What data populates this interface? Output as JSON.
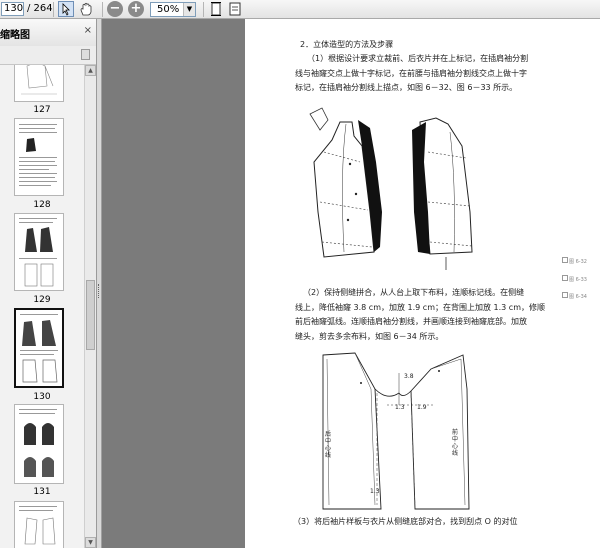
{
  "toolbar": {
    "page_current": "130",
    "page_total": "/ 264",
    "zoom": "50%",
    "icons": [
      "text-select-icon",
      "hand-icon",
      "zoom-out-icon",
      "zoom-in-icon",
      "fit-page-icon",
      "fit-width-icon"
    ]
  },
  "sidebar": {
    "title": "缩略图",
    "close_glyph": "×",
    "thumbnails": [
      {
        "label": "127"
      },
      {
        "label": "128"
      },
      {
        "label": "129"
      },
      {
        "label": "130",
        "selected": true
      },
      {
        "label": "131"
      }
    ]
  },
  "doc": {
    "heading": "2．立体造型的方法及步骤",
    "para1": [
      "（1）根据设计要求立裁前、后衣片并在上标记，在插肩袖分割",
      "线与袖窿交点上做十字标记，在前腰与插肩袖分割线交点上做十字",
      "标记，在插肩袖分割线上描点，如图 6－32、图 6－33 所示。"
    ],
    "para2": [
      "（2）保持侧缝拼合，从人台上取下布料，连顺标记线。在侧缝",
      "线上，降低袖窿 3.8 cm，加放 1.9 cm；在背围上加放 1.3 cm，修顺",
      "前后袖窿弧线。连顺插肩袖分割线，并画顺连接到袖窿底部。加放",
      "缝头，剪去多余布料，如图 6－34 所示。"
    ],
    "para3": "（3）将后袖片样板与衣片从侧缝底部对合，找到刮点 O 的对位",
    "pattern": {
      "back_label": "后中心线",
      "front_label": "前中心线",
      "marks": [
        "3.8",
        "1.3",
        "1.9",
        "1.3"
      ]
    },
    "fig_notes": [
      "图 6-32",
      "图 6-33",
      "图 6-34"
    ]
  }
}
